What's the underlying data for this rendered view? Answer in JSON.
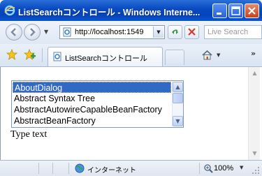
{
  "window": {
    "title": "ListSearchコントロール - Windows Interne..."
  },
  "navigation": {
    "address": "http://localhost:1549",
    "search_placeholder": "Live Search"
  },
  "tabs": [
    {
      "label": "ListSearchコントロール"
    }
  ],
  "listbox": {
    "items": [
      {
        "label": "AboutDialog",
        "selected": true
      },
      {
        "label": "Abstract Syntax Tree",
        "selected": false
      },
      {
        "label": "AbstractAutowireCapableBeanFactory",
        "selected": false
      },
      {
        "label": "AbstractBeanFactory",
        "selected": false
      }
    ]
  },
  "content": {
    "prompt_text": "Type text"
  },
  "status": {
    "zone": "インターネット",
    "zoom": "100%"
  },
  "colors": {
    "selection": "#316ac5",
    "titlebar": "#0a4bc3"
  },
  "icons": [
    "ie-icon",
    "back-icon",
    "forward-icon",
    "page-icon",
    "refresh-icon",
    "stop-icon",
    "favorites-star-icon",
    "add-favorite-icon",
    "home-icon",
    "globe-icon",
    "zoom-icon"
  ]
}
